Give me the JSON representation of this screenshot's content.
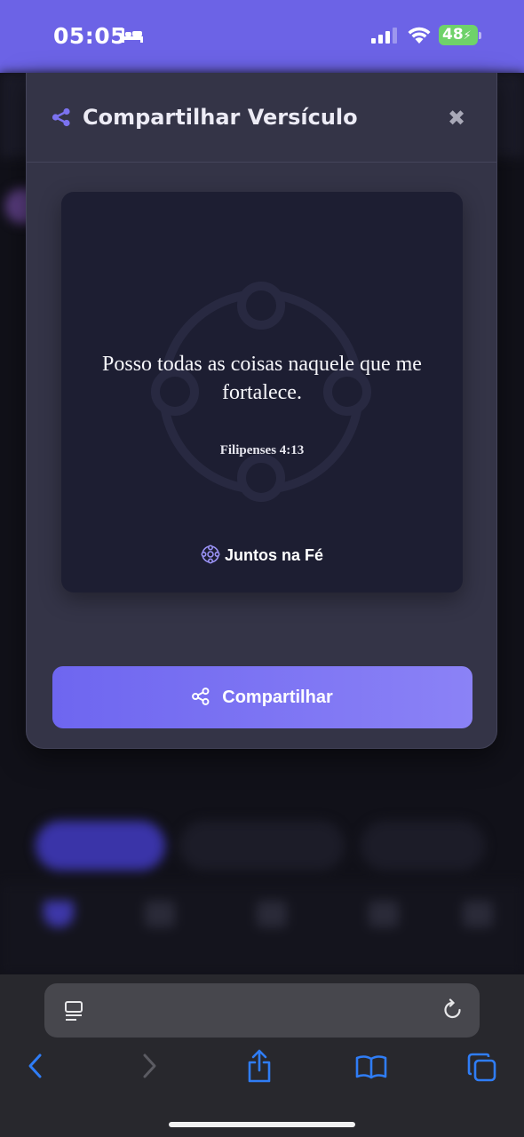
{
  "status_bar": {
    "time": "05:05",
    "battery": "48"
  },
  "modal": {
    "title": "Compartilhar Versículo",
    "close_label": "✖",
    "verse": {
      "text": "Posso todas as coisas naquele que me fortalece.",
      "reference": "Filipenses 4:13",
      "brand": "Juntos na Fé"
    },
    "share_button_label": "Compartilhar"
  },
  "colors": {
    "accent": "#6c63e6",
    "modal_bg": "#343447",
    "card_bg": "#1d1e32",
    "browser_accent": "#2f7df6"
  },
  "icons": {
    "share": "share-icon",
    "close": "close-icon",
    "brand": "community-circle-icon",
    "reader": "reader-icon",
    "reload": "reload-icon",
    "back": "chevron-left-icon",
    "forward": "chevron-right-icon",
    "share_sheet": "share-sheet-icon",
    "bookmarks": "book-icon",
    "tabs": "tabs-icon"
  }
}
